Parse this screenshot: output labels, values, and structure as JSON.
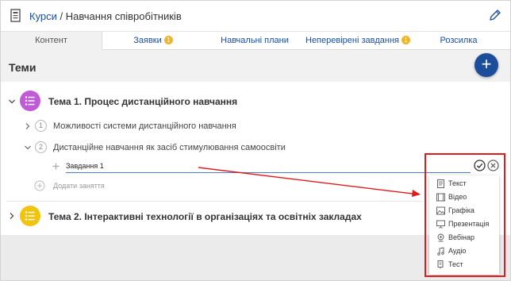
{
  "header": {
    "breadcrumb_link": "Курси",
    "breadcrumb_separator": " / ",
    "title": "Навчання співробітників"
  },
  "tabs": [
    {
      "label": "Контент",
      "active": true,
      "badge": ""
    },
    {
      "label": "Заявки",
      "active": false,
      "badge": "1"
    },
    {
      "label": "Навчальні плани",
      "active": false,
      "badge": ""
    },
    {
      "label": "Неперевірені завдання",
      "active": false,
      "badge": "1"
    },
    {
      "label": "Розсилка",
      "active": false,
      "badge": ""
    }
  ],
  "section": {
    "title": "Теми",
    "add_button": "+"
  },
  "topics": [
    {
      "title": "Тема 1. Процес дистанційного навчання",
      "color": "#c05ad6",
      "lessons": [
        {
          "number": "1",
          "title": "Можливості системи дистанційного навчання"
        },
        {
          "number": "2",
          "title": "Дистанційне навчання як засіб стимулювання самоосвіти"
        }
      ],
      "new_task_value": "Завдання 1",
      "add_lesson_label": "Додати заняття"
    },
    {
      "title": "Тема 2. Інтерактивні технології в організаціях та освітніх закладах",
      "color": "#f1c40f"
    }
  ],
  "task_type_menu": [
    {
      "label": "Текст",
      "icon": "text-doc-icon"
    },
    {
      "label": "Відео",
      "icon": "video-film-icon"
    },
    {
      "label": "Графіка",
      "icon": "image-icon"
    },
    {
      "label": "Презентація",
      "icon": "presentation-icon"
    },
    {
      "label": "Вебінар",
      "icon": "webinar-icon"
    },
    {
      "label": "Аудіо",
      "icon": "audio-note-icon"
    },
    {
      "label": "Тест",
      "icon": "test-icon"
    }
  ],
  "colors": {
    "accent": "#1a4fa0",
    "fab": "#1c4d9b",
    "badge": "#f0b429",
    "annotation": "#e01b1b"
  }
}
